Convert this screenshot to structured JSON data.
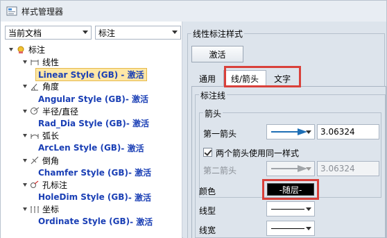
{
  "window": {
    "title": "样式管理器"
  },
  "left": {
    "scope_select": "当前文档",
    "type_select": "标注",
    "tree": {
      "root": "标注",
      "groups": [
        {
          "label": "线性",
          "style": "Linear Style (GB)",
          "active": " - 激活"
        },
        {
          "label": "角度",
          "style": "Angular Style (GB)",
          "active": " - 激活"
        },
        {
          "label": "半径/直径",
          "style": "Rad_Dia Style (GB)",
          "active": " - 激活"
        },
        {
          "label": "弧长",
          "style": "ArcLen Style (GB)",
          "active": " - 激活"
        },
        {
          "label": "倒角",
          "style": "Chamfer Style (GB)",
          "active": " - 激活"
        },
        {
          "label": "孔标注",
          "style": "HoleDim Style (GB)",
          "active": " - 激活"
        },
        {
          "label": "坐标",
          "style": "Ordinate Style (GB)",
          "active": " - 激活"
        }
      ]
    }
  },
  "right": {
    "group_title": "线性标注样式",
    "activate_button": "激活",
    "tabs": [
      "通用",
      "线/箭头",
      "文字"
    ],
    "active_tab": "线/箭头",
    "section_title": "标注线",
    "arrow_group": "箭头",
    "first_arrow_label": "第一箭头",
    "first_arrow_size": "3.06324",
    "same_arrow_checkbox": "两个箭头使用同一样式",
    "second_arrow_label": "第二箭头",
    "second_arrow_size": "3.06324",
    "color_label": "颜色",
    "color_value": "-随层-",
    "linetype_label": "线型",
    "linewidth_label": "线宽"
  },
  "colors": {
    "arrow_blue": "#1f6fb5",
    "active_style_blue": "#1a3fb5",
    "highlight_red": "#d9403a",
    "selection_yellow": "#fde7a6"
  }
}
